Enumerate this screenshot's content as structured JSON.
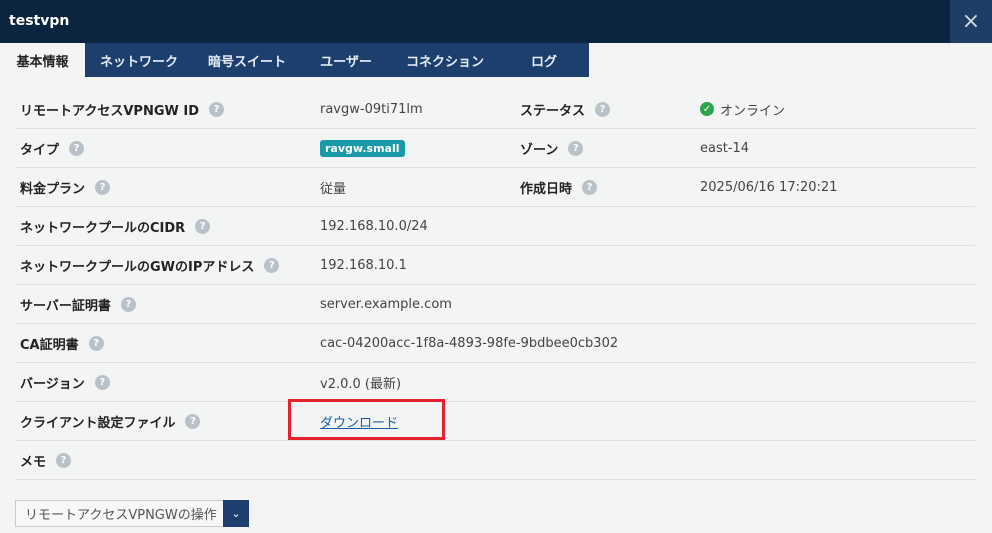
{
  "window": {
    "title": "testvpn",
    "close_icon": "×"
  },
  "tabs": [
    {
      "label": "基本情報",
      "active": true
    },
    {
      "label": "ネットワーク",
      "active": false
    },
    {
      "label": "暗号スイート",
      "active": false
    },
    {
      "label": "ユーザー",
      "active": false
    },
    {
      "label": "コネクション",
      "active": false
    },
    {
      "label": "ログ",
      "active": false
    }
  ],
  "help_icon": "?",
  "rows": [
    {
      "label": "リモートアクセスVPNGW ID",
      "value": "ravgw-09ti71lm",
      "label2": "ステータス",
      "value2": "オンライン"
    },
    {
      "label": "タイプ",
      "value": "ravgw.small",
      "label2": "ゾーン",
      "value2": "east-14"
    },
    {
      "label": "料金プラン",
      "value": "従量",
      "label2": "作成日時",
      "value2": "2025/06/16 17:20:21"
    },
    {
      "label": "ネットワークプールのCIDR",
      "value": "192.168.10.0/24"
    },
    {
      "label": "ネットワークプールのGWのIPアドレス",
      "value": "192.168.10.1"
    },
    {
      "label": "サーバー証明書",
      "value": "server.example.com"
    },
    {
      "label": "CA証明書",
      "value": "cac-04200acc-1f8a-4893-98fe-9bdbee0cb302"
    },
    {
      "label": "バージョン",
      "value": "v2.0.0 (最新)"
    },
    {
      "label": "クライアント設定ファイル",
      "value": "ダウンロード"
    },
    {
      "label": "メモ",
      "value": ""
    }
  ],
  "status_icon": "✓",
  "operations": {
    "label": "リモートアクセスVPNGWの操作",
    "arrow": "⌄"
  },
  "colors": {
    "titlebar": "#0b2440",
    "tabstrip": "#1c3f6e",
    "badge": "#1a9aa8",
    "status_ok": "#2ea44f",
    "link": "#1a5da8",
    "highlight": "#e3222c"
  }
}
